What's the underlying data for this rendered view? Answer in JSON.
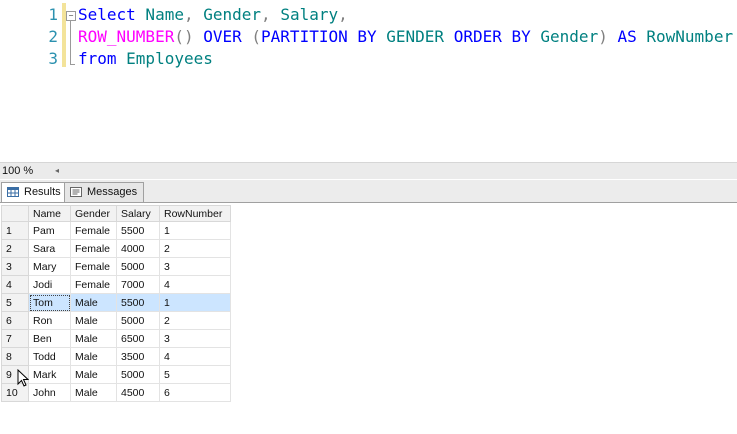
{
  "editor": {
    "lines": [
      {
        "number": "1",
        "parts": [
          {
            "t": "Select",
            "c": "kw"
          },
          {
            "t": " Name",
            "c": "id"
          },
          {
            "t": ",",
            "c": "gray"
          },
          {
            "t": " Gender",
            "c": "id"
          },
          {
            "t": ",",
            "c": "gray"
          },
          {
            "t": " Salary",
            "c": "id"
          },
          {
            "t": ",",
            "c": "gray"
          }
        ]
      },
      {
        "number": "2",
        "parts": [
          {
            "t": "ROW_NUMBER",
            "c": "fn"
          },
          {
            "t": "()",
            "c": "gray"
          },
          {
            "t": " OVER ",
            "c": "kw"
          },
          {
            "t": "(",
            "c": "gray"
          },
          {
            "t": "PARTITION BY",
            "c": "kw"
          },
          {
            "t": " GENDER",
            "c": "id"
          },
          {
            "t": " ORDER BY",
            "c": "kw"
          },
          {
            "t": " Gender",
            "c": "id"
          },
          {
            "t": ")",
            "c": "gray"
          },
          {
            "t": " AS",
            "c": "kw"
          },
          {
            "t": " RowNumber",
            "c": "id"
          }
        ]
      },
      {
        "number": "3",
        "parts": [
          {
            "t": "from",
            "c": "kw"
          },
          {
            "t": " Employees",
            "c": "id"
          }
        ]
      }
    ]
  },
  "zoom": {
    "value": "100 %",
    "arrow": "◂"
  },
  "tabs": [
    {
      "label": "Results",
      "icon": "grid-icon",
      "active": true
    },
    {
      "label": "Messages",
      "icon": "messages-icon",
      "active": false
    }
  ],
  "grid": {
    "columns": [
      "Name",
      "Gender",
      "Salary",
      "RowNumber"
    ],
    "rows": [
      {
        "n": "1",
        "cells": [
          "Pam",
          "Female",
          "5500",
          "1"
        ]
      },
      {
        "n": "2",
        "cells": [
          "Sara",
          "Female",
          "4000",
          "2"
        ]
      },
      {
        "n": "3",
        "cells": [
          "Mary",
          "Female",
          "5000",
          "3"
        ]
      },
      {
        "n": "4",
        "cells": [
          "Jodi",
          "Female",
          "7000",
          "4"
        ]
      },
      {
        "n": "5",
        "cells": [
          "Tom",
          "Male",
          "5500",
          "1"
        ],
        "selected": true
      },
      {
        "n": "6",
        "cells": [
          "Ron",
          "Male",
          "5000",
          "2"
        ]
      },
      {
        "n": "7",
        "cells": [
          "Ben",
          "Male",
          "6500",
          "3"
        ]
      },
      {
        "n": "8",
        "cells": [
          "Todd",
          "Male",
          "3500",
          "4"
        ]
      },
      {
        "n": "9",
        "cells": [
          "Mark",
          "Male",
          "5000",
          "5"
        ]
      },
      {
        "n": "10",
        "cells": [
          "John",
          "Male",
          "4500",
          "6"
        ]
      }
    ]
  },
  "colors": {
    "keyword": "#0000ff",
    "function": "#ff00ff",
    "identifier": "#008080",
    "line_number": "#2b91af",
    "selection": "#cce5ff"
  }
}
